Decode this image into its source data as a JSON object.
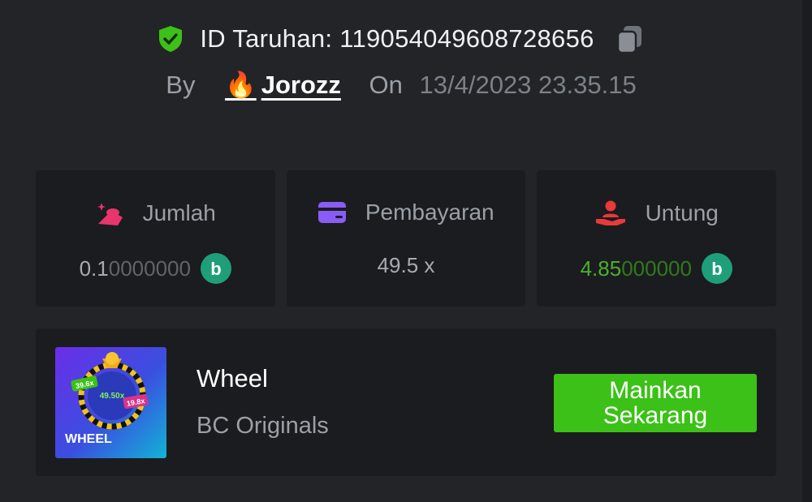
{
  "bet": {
    "id_label": "ID Taruhan: 119054049608728656",
    "by_label": "By",
    "user_emoji": "🔥",
    "user_name": "Jorozz",
    "on_label": "On",
    "date": "13/4/2023 23.35.15"
  },
  "stats": {
    "amount": {
      "label": "Jumlah",
      "value_main": "0.1",
      "value_dim": "0000000",
      "icon": "coins-icon"
    },
    "payout": {
      "label": "Pembayaran",
      "value": "49.5 x",
      "icon": "card-icon"
    },
    "profit": {
      "label": "Untung",
      "value_main": "4.85",
      "value_dim": "000000",
      "icon": "hand-profit-icon"
    },
    "currency_glyph": "b"
  },
  "game": {
    "title": "Wheel",
    "provider": "BC Originals",
    "play_button": "Mainkan Sekarang",
    "thumb_text": "WHEEL",
    "thumb_badges": [
      "39.6x",
      "49.50x",
      "19.8x"
    ]
  },
  "colors": {
    "background": "#232427",
    "card": "#1b1c1f",
    "accent_green": "#3bc117",
    "profit_green": "#4caf2d",
    "shield_green": "#3bc117",
    "icon_pink": "#e8356e",
    "icon_purple": "#8a5cf6",
    "icon_red": "#e83a3a",
    "coin_teal": "#1f9e7a"
  }
}
